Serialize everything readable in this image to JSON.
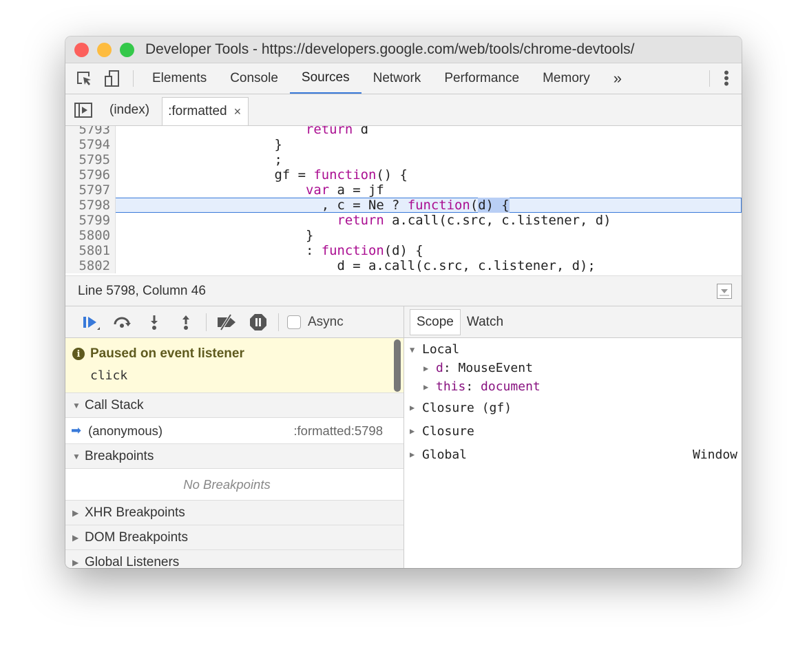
{
  "window": {
    "title": "Developer Tools - https://developers.google.com/web/tools/chrome-devtools/",
    "traffic_lights": [
      "#fc605c",
      "#fdbc40",
      "#34c84a"
    ]
  },
  "toolbar": {
    "tabs": [
      "Elements",
      "Console",
      "Sources",
      "Network",
      "Performance",
      "Memory"
    ],
    "active": "Sources",
    "more": "»",
    "accent": "#3879d9"
  },
  "file_tabs": {
    "items": [
      "(index)",
      ":formatted"
    ],
    "active": ":formatted",
    "close": "×"
  },
  "code": {
    "lines": [
      {
        "n": "5793",
        "t": [
          [
            "s",
            "                        "
          ],
          [
            "k",
            "return"
          ],
          [
            "s",
            " d"
          ]
        ]
      },
      {
        "n": "5794",
        "t": [
          [
            "s",
            "                    }"
          ]
        ]
      },
      {
        "n": "5795",
        "t": [
          [
            "s",
            "                    ;"
          ]
        ]
      },
      {
        "n": "5796",
        "t": [
          [
            "s",
            "                    gf = "
          ],
          [
            "k",
            "function"
          ],
          [
            "s",
            "() {"
          ]
        ]
      },
      {
        "n": "5797",
        "t": [
          [
            "s",
            "                        "
          ],
          [
            "k",
            "var"
          ],
          [
            "s",
            " a = jf"
          ]
        ]
      },
      {
        "n": "5798",
        "t": [
          [
            "s",
            "                          , c = Ne ? "
          ],
          [
            "k",
            "function"
          ],
          [
            "s",
            "("
          ],
          [
            "x",
            "d) {"
          ]
        ],
        "current": true
      },
      {
        "n": "5799",
        "t": [
          [
            "s",
            "                            "
          ],
          [
            "k",
            "return"
          ],
          [
            "s",
            " a.call(c.src, c.listener, d)"
          ]
        ]
      },
      {
        "n": "5800",
        "t": [
          [
            "s",
            "                        }"
          ]
        ]
      },
      {
        "n": "5801",
        "t": [
          [
            "s",
            "                        : "
          ],
          [
            "k",
            "function"
          ],
          [
            "s",
            "(d) {"
          ]
        ]
      },
      {
        "n": "5802",
        "t": [
          [
            "s",
            "                            d = a.call(c.src, c.listener, d);"
          ]
        ]
      }
    ]
  },
  "status": {
    "position": "Line 5798, Column 46"
  },
  "debugger": {
    "async_label": "Async",
    "async_checked": false,
    "paused": {
      "title": "Paused on event listener",
      "event": "click"
    },
    "call_stack": {
      "label": "Call Stack",
      "frames": [
        {
          "name": "(anonymous)",
          "location": ":formatted:5798"
        }
      ]
    },
    "breakpoints": {
      "label": "Breakpoints",
      "empty": "No Breakpoints"
    },
    "sections": [
      "XHR Breakpoints",
      "DOM Breakpoints",
      "Global Listeners"
    ]
  },
  "scope": {
    "tabs": [
      "Scope",
      "Watch"
    ],
    "active": "Scope",
    "local": {
      "label": "Local",
      "props": [
        {
          "name": "d",
          "value": "MouseEvent"
        },
        {
          "name": "this",
          "value": "document"
        }
      ]
    },
    "groups": [
      {
        "label": "Closure (gf)",
        "value": ""
      },
      {
        "label": "Closure",
        "value": ""
      },
      {
        "label": "Global",
        "value": "Window"
      }
    ]
  }
}
